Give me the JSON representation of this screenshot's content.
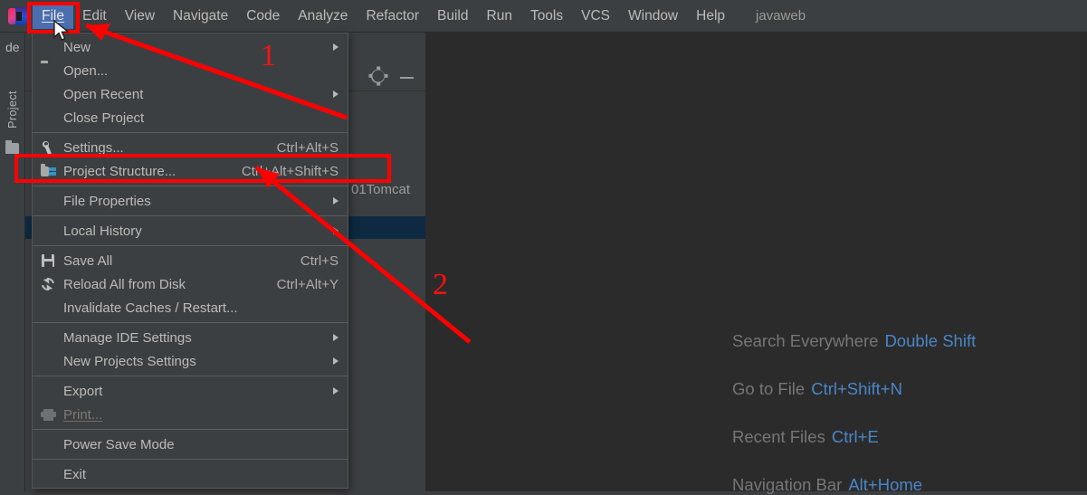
{
  "app": {
    "logo_icon": "intellij-idea-logo",
    "project_name": "javaweb"
  },
  "menubar": {
    "items": [
      {
        "label": "File",
        "mnemonic": "F",
        "active": true
      },
      {
        "label": "Edit",
        "mnemonic": "E",
        "active": false
      },
      {
        "label": "View",
        "mnemonic": "V",
        "active": false
      },
      {
        "label": "Navigate",
        "mnemonic": "N",
        "active": false
      },
      {
        "label": "Code",
        "mnemonic": "C",
        "active": false
      },
      {
        "label": "Analyze",
        "mnemonic": "z",
        "active": false
      },
      {
        "label": "Refactor",
        "mnemonic": "R",
        "active": false
      },
      {
        "label": "Build",
        "mnemonic": "B",
        "active": false
      },
      {
        "label": "Run",
        "mnemonic": "u",
        "active": false
      },
      {
        "label": "Tools",
        "mnemonic": "T",
        "active": false
      },
      {
        "label": "VCS",
        "mnemonic": "",
        "active": false
      },
      {
        "label": "Window",
        "mnemonic": "W",
        "active": false
      },
      {
        "label": "Help",
        "mnemonic": "H",
        "active": false
      }
    ]
  },
  "left_strip": {
    "tool_window_label": "Project",
    "folder_icon": "folder-icon"
  },
  "tool_window": {
    "gear_icon": "gear-icon",
    "minimize_icon": "minimize-icon",
    "tree_partial_text": "01Tomcat",
    "tree_text_top": "de"
  },
  "file_menu": {
    "rows": [
      {
        "label": "New",
        "icon": "",
        "shortcut": "",
        "submenu": true,
        "disabled": false,
        "mnemonic": "N"
      },
      {
        "label": "Open...",
        "icon": "folder-icon",
        "shortcut": "",
        "submenu": false,
        "disabled": false,
        "mnemonic": "O"
      },
      {
        "label": "Open Recent",
        "icon": "",
        "shortcut": "",
        "submenu": true,
        "disabled": false,
        "mnemonic": "R"
      },
      {
        "label": "Close Project",
        "icon": "",
        "shortcut": "",
        "submenu": false,
        "disabled": false,
        "mnemonic": ""
      },
      {
        "separator": true
      },
      {
        "label": "Settings...",
        "icon": "wrench-icon",
        "shortcut": "Ctrl+Alt+S",
        "submenu": false,
        "disabled": false,
        "mnemonic": "t"
      },
      {
        "label": "Project Structure...",
        "icon": "project-structure-icon",
        "shortcut": "Ctrl+Alt+Shift+S",
        "submenu": false,
        "disabled": false,
        "mnemonic": ""
      },
      {
        "separator": true
      },
      {
        "label": "File Properties",
        "icon": "",
        "shortcut": "",
        "submenu": true,
        "disabled": false,
        "mnemonic": ""
      },
      {
        "separator": true
      },
      {
        "label": "Local History",
        "icon": "",
        "shortcut": "",
        "submenu": true,
        "disabled": false,
        "mnemonic": "H"
      },
      {
        "separator": true
      },
      {
        "label": "Save All",
        "icon": "save-icon",
        "shortcut": "Ctrl+S",
        "submenu": false,
        "disabled": false,
        "mnemonic": "S"
      },
      {
        "label": "Reload All from Disk",
        "icon": "reload-icon",
        "shortcut": "Ctrl+Alt+Y",
        "submenu": false,
        "disabled": false,
        "mnemonic": ""
      },
      {
        "label": "Invalidate Caches / Restart...",
        "icon": "",
        "shortcut": "",
        "submenu": false,
        "disabled": false,
        "mnemonic": ""
      },
      {
        "separator": true
      },
      {
        "label": "Manage IDE Settings",
        "icon": "",
        "shortcut": "",
        "submenu": true,
        "disabled": false,
        "mnemonic": ""
      },
      {
        "label": "New Projects Settings",
        "icon": "",
        "shortcut": "",
        "submenu": true,
        "disabled": false,
        "mnemonic": ""
      },
      {
        "separator": true
      },
      {
        "label": "Export",
        "icon": "",
        "shortcut": "",
        "submenu": true,
        "disabled": false,
        "mnemonic": ""
      },
      {
        "label": "Print...",
        "icon": "print-icon",
        "shortcut": "",
        "submenu": false,
        "disabled": true,
        "mnemonic": "P"
      },
      {
        "separator": true
      },
      {
        "label": "Power Save Mode",
        "icon": "",
        "shortcut": "",
        "submenu": false,
        "disabled": false,
        "mnemonic": ""
      },
      {
        "separator": true
      },
      {
        "label": "Exit",
        "icon": "",
        "shortcut": "",
        "submenu": false,
        "disabled": false,
        "mnemonic": "x"
      }
    ]
  },
  "editor_hints": {
    "accent_color": "#4a86c8",
    "items": [
      {
        "action": "Search Everywhere",
        "keys": "Double Shift"
      },
      {
        "action": "Go to File",
        "keys": "Ctrl+Shift+N"
      },
      {
        "action": "Recent Files",
        "keys": "Ctrl+E"
      },
      {
        "action": "Navigation Bar",
        "keys": "Alt+Home"
      }
    ]
  },
  "annotations": {
    "color": "#ff0000",
    "step_one": "1",
    "step_two": "2"
  }
}
